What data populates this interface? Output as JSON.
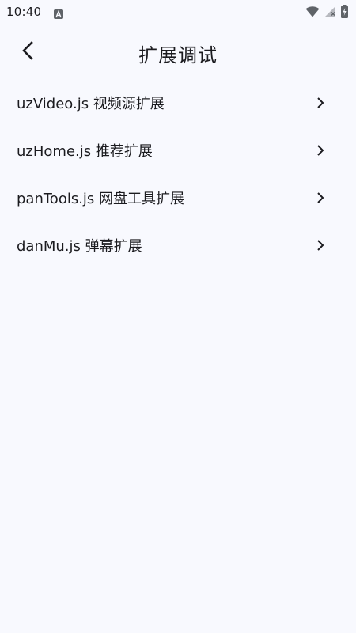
{
  "status_bar": {
    "time": "10:40",
    "icons": [
      "a-notification-icon",
      "wifi-icon",
      "cell-signal-icon",
      "battery-charging-icon"
    ]
  },
  "app_bar": {
    "title": "扩展调试",
    "back_icon": "chevron-left-icon"
  },
  "list": {
    "items": [
      {
        "label": "uzVideo.js 视频源扩展"
      },
      {
        "label": "uzHome.js 推荐扩展"
      },
      {
        "label": "panTools.js 网盘工具扩展"
      },
      {
        "label": "danMu.js 弹幕扩展"
      }
    ],
    "trailing_icon": "chevron-right-icon"
  },
  "colors": {
    "background": "#f8f9fe",
    "text": "#1b1b1f"
  }
}
